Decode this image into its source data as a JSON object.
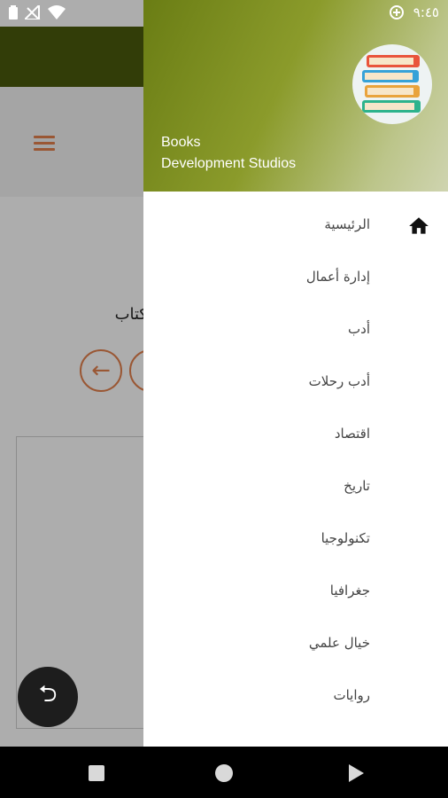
{
  "status_bar": {
    "time": "٩:٤٥",
    "icons": [
      "battery-icon",
      "signal-icon",
      "wifi-icon",
      "data-saver-icon"
    ]
  },
  "colors": {
    "toolbar": "#4b5a0c",
    "accent": "#e3804d",
    "header_gradient_start": "#6a7d14",
    "fab": "#1d1d1d"
  },
  "background": {
    "title_fragment": "كتاب",
    "back_icon": "arrow-left-icon",
    "fab_icon": "undo-icon"
  },
  "drawer": {
    "header": {
      "title": "Books",
      "subtitle": "Development Studios",
      "avatar_icon": "book-stack-icon"
    },
    "items": [
      {
        "label": "الرئيسية",
        "icon": "home-icon"
      },
      {
        "label": "إدارة أعمال"
      },
      {
        "label": "أدب"
      },
      {
        "label": "أدب رحلات"
      },
      {
        "label": "اقتصاد"
      },
      {
        "label": "تاريخ"
      },
      {
        "label": "تكنولوجيا"
      },
      {
        "label": "جغرافيا"
      },
      {
        "label": "خيال علمي"
      },
      {
        "label": "روايات"
      },
      {
        "label": ""
      }
    ]
  },
  "nav_bar": {
    "buttons": [
      "recents-icon",
      "home-circle-icon",
      "back-triangle-icon"
    ]
  }
}
